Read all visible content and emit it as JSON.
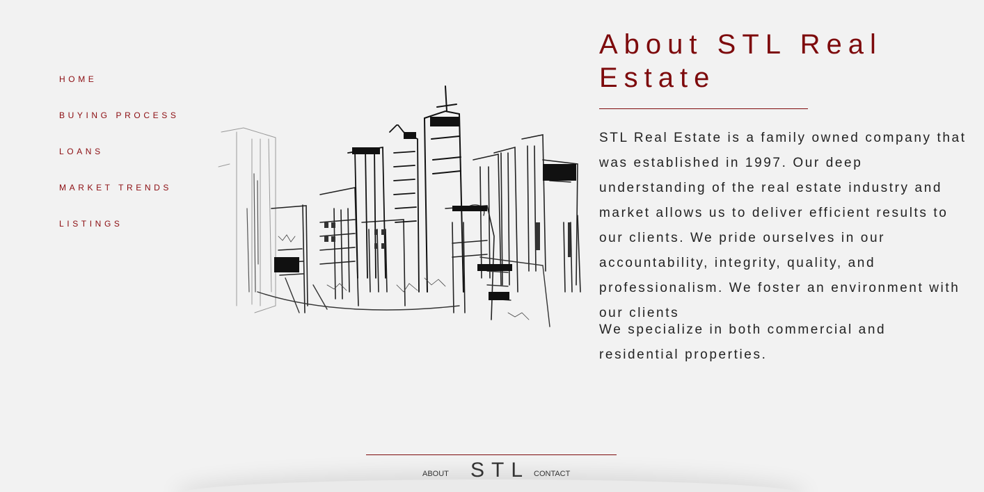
{
  "nav": {
    "items": [
      {
        "label": "HOME"
      },
      {
        "label": "BUYING PROCESS"
      },
      {
        "label": "LOANS"
      },
      {
        "label": "MARKET TRENDS"
      },
      {
        "label": "LISTINGS"
      }
    ]
  },
  "main": {
    "title": "About STL Real Estate",
    "paragraphs": [
      "STL Real Estate is a family owned company that was established in 1997. Our deep understanding of the real estate industry and market allows us to deliver efficient results to our clients. We pride ourselves in our accountability, integrity, quality, and professionalism. We foster an environment with our clients",
      "We specialize in both commercial and residential properties."
    ]
  },
  "footer": {
    "about_label": "ABOUT",
    "logo": "STL",
    "contact_label": "CONTACT"
  },
  "colors": {
    "accent": "#8b0c10",
    "background": "#f2f2f2",
    "text": "#222222"
  },
  "icons": {
    "hero": "city-skyline-sketch"
  }
}
